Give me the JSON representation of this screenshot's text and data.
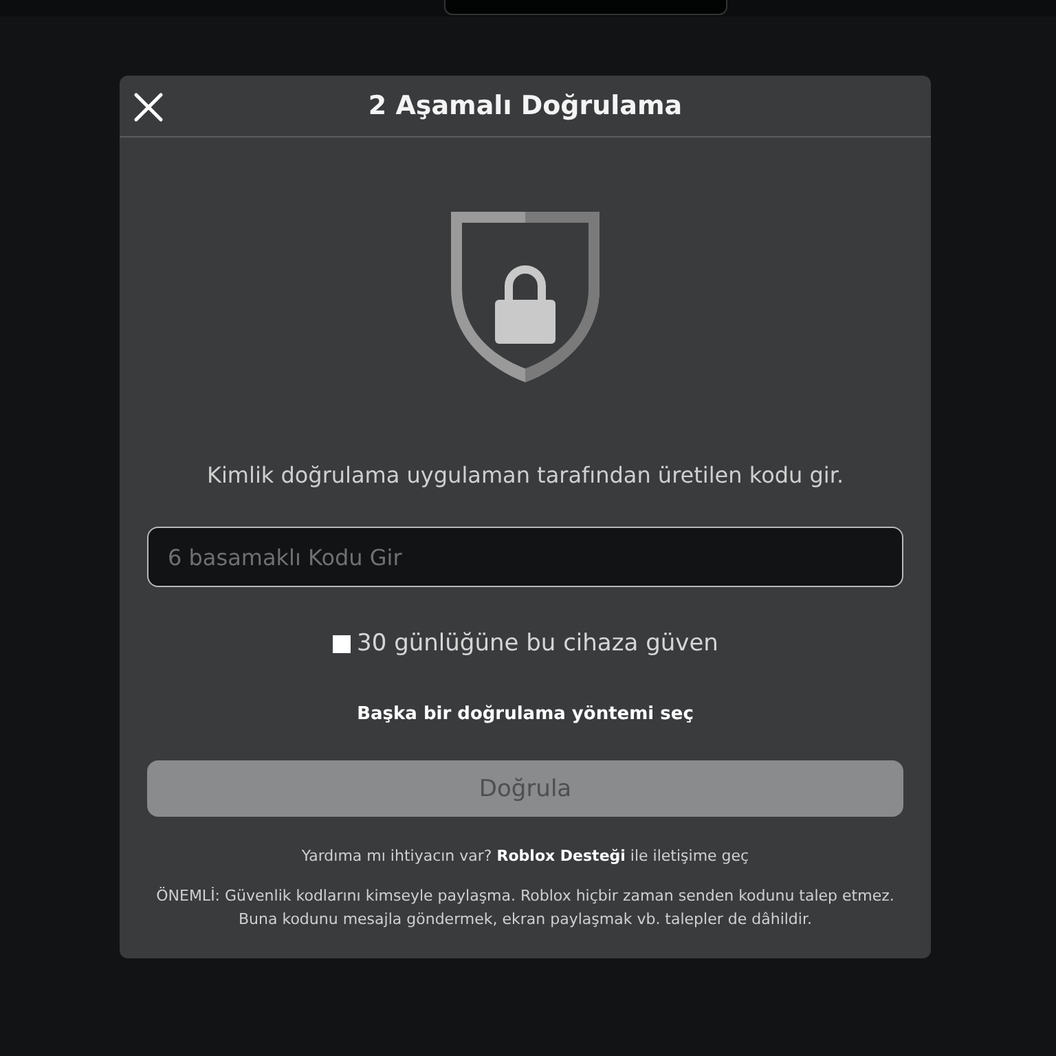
{
  "dialog": {
    "title": "2 Aşamalı Doğrulama",
    "instruction": "Kimlik doğrulama uygulaman tarafından üretilen kodu gir.",
    "code_field": {
      "placeholder": "6 basamaklı Kodu Gir"
    },
    "trust_device": {
      "label": "30 günlüğüne bu cihaza güven",
      "checked": false
    },
    "other_method_link": "Başka bir doğrulama yöntemi seç",
    "verify_button": {
      "label": "Doğrula",
      "disabled": true
    },
    "help": {
      "before": "Yardıma mı ihtiyacın var?",
      "link": "Roblox Desteği",
      "after": "ile iletişime geç"
    },
    "notice": "ÖNEMLİ: Güvenlik kodlarını kimseyle paylaşma. Roblox hiçbir zaman senden kodunu talep etmez. Buna kodunu mesajla göndermek, ekran paylaşmak vb. talepler de dâhildir."
  }
}
